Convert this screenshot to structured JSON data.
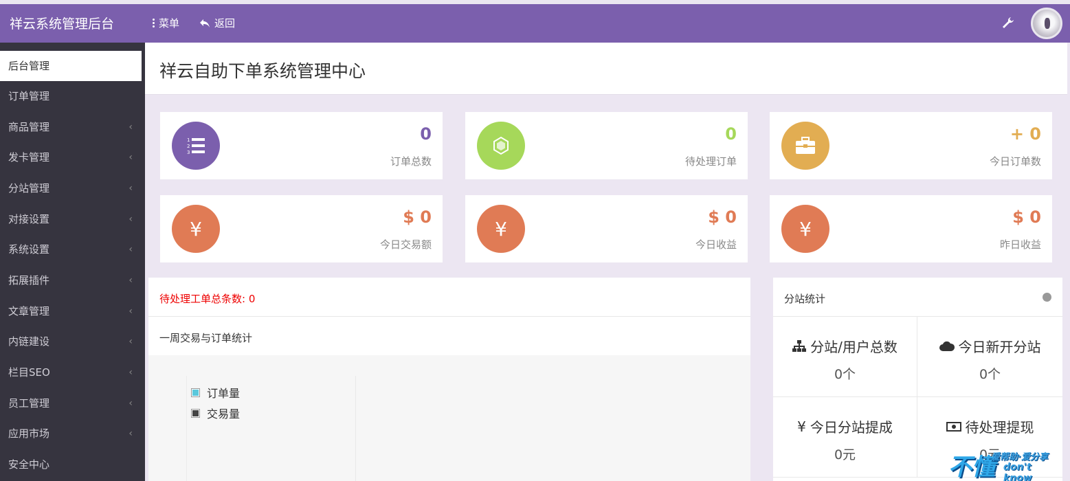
{
  "topbar": {
    "brand": "祥云系统管理后台",
    "menu_label": "菜单",
    "back_label": "返回",
    "bg_color": "#7b5fad"
  },
  "sidebar": {
    "items": [
      {
        "label": "后台管理",
        "active": true,
        "has_chevron": false
      },
      {
        "label": "订单管理",
        "has_chevron": false
      },
      {
        "label": "商品管理",
        "has_chevron": true
      },
      {
        "label": "发卡管理",
        "has_chevron": true
      },
      {
        "label": "分站管理",
        "has_chevron": true
      },
      {
        "label": "对接设置",
        "has_chevron": true
      },
      {
        "label": "系统设置",
        "has_chevron": true
      },
      {
        "label": "拓展插件",
        "has_chevron": true
      },
      {
        "label": "文章管理",
        "has_chevron": true
      },
      {
        "label": "内链建设",
        "has_chevron": true
      },
      {
        "label": "栏目SEO",
        "has_chevron": true
      },
      {
        "label": "员工管理",
        "has_chevron": true
      },
      {
        "label": "应用市场",
        "has_chevron": true
      },
      {
        "label": "安全中心",
        "has_chevron": false
      }
    ],
    "chevron": "‹"
  },
  "page": {
    "title": "祥云自助下单系统管理中心"
  },
  "stats": [
    {
      "value": "0",
      "label": "订单总数",
      "icon": "list-icon",
      "color": "#7b5fad",
      "value_color": "#7b5fad"
    },
    {
      "value": "0",
      "label": "待处理订单",
      "icon": "spinner-icon",
      "color": "#a6d85a",
      "value_color": "#a6d85a"
    },
    {
      "value": "+ 0",
      "label": "今日订单数",
      "icon": "briefcase-icon",
      "color": "#e2ad52",
      "value_color": "#e2ad52"
    },
    {
      "value": "$ 0",
      "label": "今日交易额",
      "icon": "yen-icon",
      "color": "#e07b55",
      "value_color": "#e07b55"
    },
    {
      "value": "$ 0",
      "label": "今日收益",
      "icon": "yen-icon",
      "color": "#e07b55",
      "value_color": "#e07b55"
    },
    {
      "value": "$ 0",
      "label": "昨日收益",
      "icon": "yen-icon",
      "color": "#e07b55",
      "value_color": "#e07b55"
    }
  ],
  "main_panel": {
    "pending_label": "待处理工单总条数:",
    "pending_count": "0",
    "week_title": "一周交易与订单统计",
    "legend": [
      {
        "name": "订单量",
        "color": "#5bc8dc"
      },
      {
        "name": "交易量",
        "color": "#444444"
      }
    ]
  },
  "right_panel": {
    "title": "分站统计",
    "cells": [
      {
        "title": "分站/用户总数",
        "value": "0个",
        "icon": "sitemap-icon"
      },
      {
        "title": "今日新开分站",
        "value": "0个",
        "icon": "cloud-icon"
      },
      {
        "title": "今日分站提成",
        "value": "0元",
        "icon": "yen-icon"
      },
      {
        "title": "待处理提现",
        "value": "0元",
        "icon": "money-icon"
      }
    ],
    "yen_glyph": "¥"
  },
  "watermark": {
    "big": "不懂",
    "small": "爱帮助·爱分享",
    "small2": "don't know"
  }
}
